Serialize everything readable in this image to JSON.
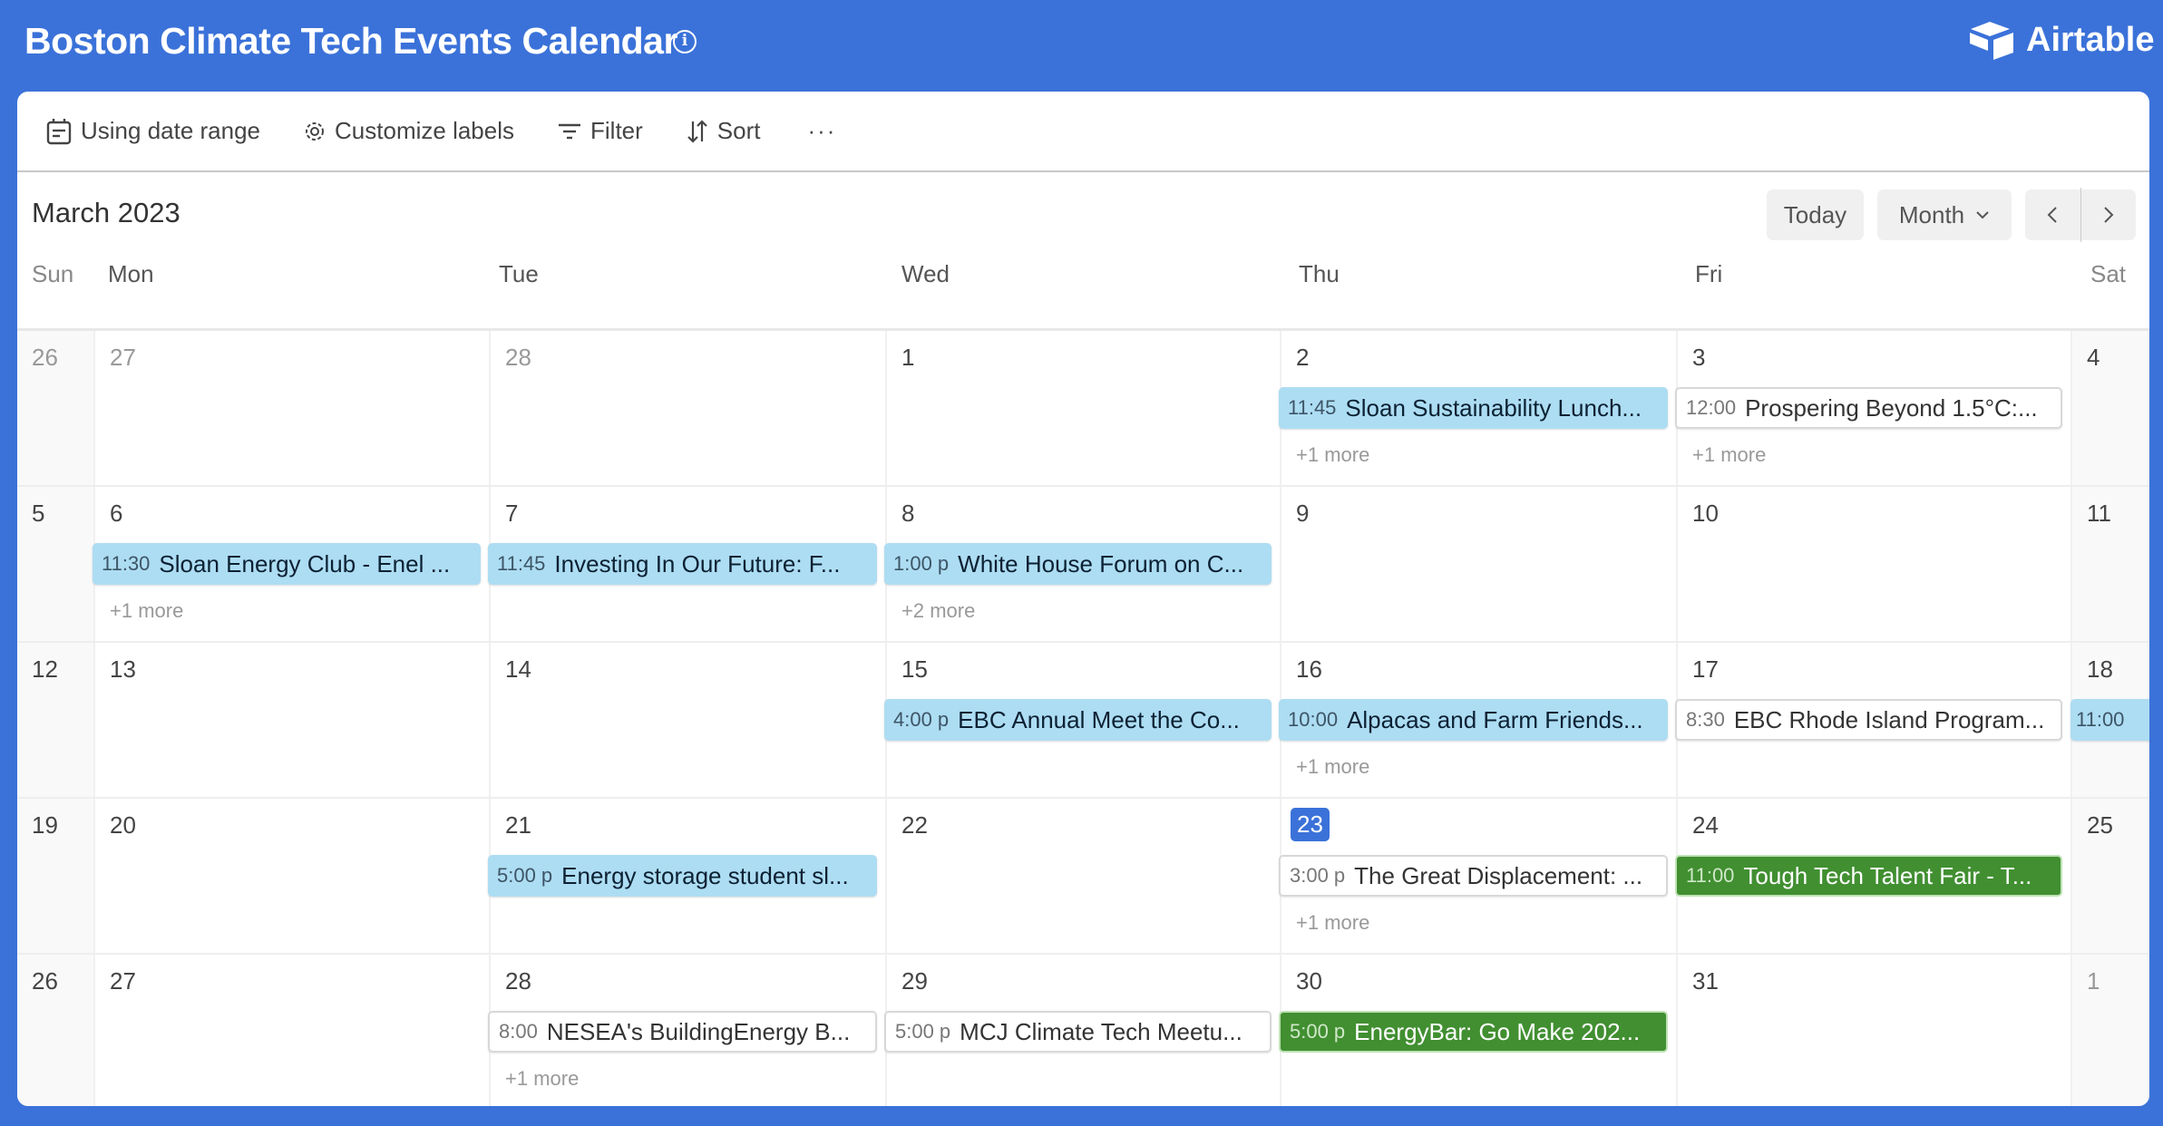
{
  "header": {
    "title": "Boston Climate Tech Events Calendar",
    "info_icon": "info-circle-icon",
    "brand": "Airtable",
    "brand_icon": "airtable-logo-icon",
    "colors": {
      "header_bg": "#3B72D9",
      "today_badge": "#3B72D9",
      "event_blue": "#ADDDF3",
      "event_green": "#418F31",
      "event_white": "#FFFFFF"
    }
  },
  "toolbar": {
    "date_range": {
      "label": "Using date range",
      "icon": "calendar-icon"
    },
    "customize": {
      "label": "Customize labels",
      "icon": "gear-icon"
    },
    "filter": {
      "label": "Filter",
      "icon": "filter-icon"
    },
    "sort": {
      "label": "Sort",
      "icon": "sort-icon"
    },
    "more": "···"
  },
  "calendar": {
    "month_label": "March 2023",
    "today_label": "Today",
    "view_select": "Month",
    "weekdays": [
      "Sun",
      "Mon",
      "Tue",
      "Wed",
      "Thu",
      "Fri",
      "Sat"
    ],
    "weeks": [
      {
        "days": [
          {
            "num": "26",
            "other": true
          },
          {
            "num": "27",
            "other": true
          },
          {
            "num": "28",
            "other": true
          },
          {
            "num": "1"
          },
          {
            "num": "2",
            "event": {
              "time": "11:45",
              "name": "Sloan Sustainability Lunch...",
              "style": "blue"
            },
            "more": "+1 more"
          },
          {
            "num": "3",
            "event": {
              "time": "12:00",
              "name": "Prospering Beyond 1.5°C:...",
              "style": "white"
            },
            "more": "+1 more"
          },
          {
            "num": "4"
          }
        ]
      },
      {
        "days": [
          {
            "num": "5"
          },
          {
            "num": "6",
            "event": {
              "time": "11:30",
              "name": "Sloan Energy Club - Enel ...",
              "style": "blue"
            },
            "more": "+1 more"
          },
          {
            "num": "7",
            "event": {
              "time": "11:45",
              "name": "Investing In Our Future: F...",
              "style": "blue"
            }
          },
          {
            "num": "8",
            "event": {
              "time": "1:00 p",
              "name": "White House Forum on C...",
              "style": "blue"
            },
            "more": "+2 more"
          },
          {
            "num": "9"
          },
          {
            "num": "10"
          },
          {
            "num": "11"
          }
        ]
      },
      {
        "days": [
          {
            "num": "12"
          },
          {
            "num": "13"
          },
          {
            "num": "14"
          },
          {
            "num": "15",
            "event": {
              "time": "4:00 p",
              "name": "EBC Annual Meet the Co...",
              "style": "blue"
            }
          },
          {
            "num": "16",
            "event": {
              "time": "10:00",
              "name": "Alpacas and Farm Friends...",
              "style": "blue"
            },
            "more": "+1 more"
          },
          {
            "num": "17",
            "event": {
              "time": "8:30",
              "name": "EBC Rhode Island Program...",
              "style": "white"
            }
          },
          {
            "num": "18",
            "event": {
              "time": "11:00",
              "name": "",
              "style": "blue"
            }
          }
        ]
      },
      {
        "days": [
          {
            "num": "19"
          },
          {
            "num": "20"
          },
          {
            "num": "21",
            "event": {
              "time": "5:00 p",
              "name": "Energy storage student sl...",
              "style": "blue"
            }
          },
          {
            "num": "22"
          },
          {
            "num": "23",
            "today": true,
            "event": {
              "time": "3:00 p",
              "name": "The Great Displacement: ...",
              "style": "white"
            },
            "more": "+1 more"
          },
          {
            "num": "24",
            "event": {
              "time": "11:00",
              "name": "Tough Tech Talent Fair - T...",
              "style": "green"
            }
          },
          {
            "num": "25"
          }
        ]
      },
      {
        "days": [
          {
            "num": "26"
          },
          {
            "num": "27"
          },
          {
            "num": "28",
            "event": {
              "time": "8:00",
              "name": "NESEA's BuildingEnergy B...",
              "style": "white"
            },
            "more": "+1 more"
          },
          {
            "num": "29",
            "event": {
              "time": "5:00 p",
              "name": "MCJ Climate Tech Meetu...",
              "style": "white"
            }
          },
          {
            "num": "30",
            "event": {
              "time": "5:00 p",
              "name": "EnergyBar: Go Make 202...",
              "style": "green"
            }
          },
          {
            "num": "31"
          },
          {
            "num": "1",
            "other": true
          }
        ]
      }
    ]
  }
}
